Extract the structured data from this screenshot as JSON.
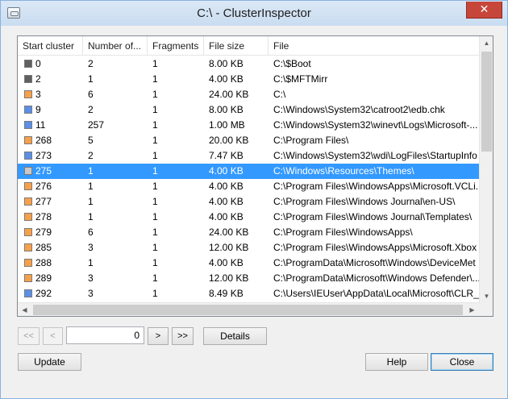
{
  "window": {
    "title": "C:\\ - ClusterInspector",
    "close_glyph": "✕"
  },
  "columns": [
    "Start cluster",
    "Number of...",
    "Fragments",
    "File size",
    "File"
  ],
  "rows": [
    {
      "cluster": "0",
      "count": "2",
      "frags": "1",
      "size": "8.00 KB",
      "file": "C:\\$Boot",
      "color": "#606060"
    },
    {
      "cluster": "2",
      "count": "1",
      "frags": "1",
      "size": "4.00 KB",
      "file": "C:\\$MFTMirr",
      "color": "#606060"
    },
    {
      "cluster": "3",
      "count": "6",
      "frags": "1",
      "size": "24.00 KB",
      "file": "C:\\",
      "color": "#f7a04a"
    },
    {
      "cluster": "9",
      "count": "2",
      "frags": "1",
      "size": "8.00 KB",
      "file": "C:\\Windows\\System32\\catroot2\\edb.chk",
      "color": "#5b8fe8"
    },
    {
      "cluster": "11",
      "count": "257",
      "frags": "1",
      "size": "1.00 MB",
      "file": "C:\\Windows\\System32\\winevt\\Logs\\Microsoft-...",
      "color": "#5b8fe8"
    },
    {
      "cluster": "268",
      "count": "5",
      "frags": "1",
      "size": "20.00 KB",
      "file": "C:\\Program Files\\",
      "color": "#f7a04a"
    },
    {
      "cluster": "273",
      "count": "2",
      "frags": "1",
      "size": "7.47 KB",
      "file": "C:\\Windows\\System32\\wdi\\LogFiles\\StartupInfo",
      "color": "#5b8fe8"
    },
    {
      "cluster": "275",
      "count": "1",
      "frags": "1",
      "size": "4.00 KB",
      "file": "C:\\Windows\\Resources\\Themes\\",
      "color": "#c8c8c8"
    },
    {
      "cluster": "276",
      "count": "1",
      "frags": "1",
      "size": "4.00 KB",
      "file": "C:\\Program Files\\WindowsApps\\Microsoft.VCLi...",
      "color": "#f7a04a"
    },
    {
      "cluster": "277",
      "count": "1",
      "frags": "1",
      "size": "4.00 KB",
      "file": "C:\\Program Files\\Windows Journal\\en-US\\",
      "color": "#f7a04a"
    },
    {
      "cluster": "278",
      "count": "1",
      "frags": "1",
      "size": "4.00 KB",
      "file": "C:\\Program Files\\Windows Journal\\Templates\\",
      "color": "#f7a04a"
    },
    {
      "cluster": "279",
      "count": "6",
      "frags": "1",
      "size": "24.00 KB",
      "file": "C:\\Program Files\\WindowsApps\\",
      "color": "#f7a04a"
    },
    {
      "cluster": "285",
      "count": "3",
      "frags": "1",
      "size": "12.00 KB",
      "file": "C:\\Program Files\\WindowsApps\\Microsoft.Xbox",
      "color": "#f7a04a"
    },
    {
      "cluster": "288",
      "count": "1",
      "frags": "1",
      "size": "4.00 KB",
      "file": "C:\\ProgramData\\Microsoft\\Windows\\DeviceMet",
      "color": "#f7a04a"
    },
    {
      "cluster": "289",
      "count": "3",
      "frags": "1",
      "size": "12.00 KB",
      "file": "C:\\ProgramData\\Microsoft\\Windows Defender\\...",
      "color": "#f7a04a"
    },
    {
      "cluster": "292",
      "count": "3",
      "frags": "1",
      "size": "8.49 KB",
      "file": "C:\\Users\\IEUser\\AppData\\Local\\Microsoft\\CLR_...",
      "color": "#5b8fe8"
    }
  ],
  "selected_row": 7,
  "pager": {
    "first": "<<",
    "prev": "<",
    "value": "0",
    "next": ">",
    "last": ">>",
    "details": "Details"
  },
  "footer": {
    "update": "Update",
    "help": "Help",
    "close": "Close"
  },
  "colors": {
    "selection": "#3399ff",
    "orange": "#f7a04a",
    "blue": "#5b8fe8",
    "dark_gray": "#606060"
  }
}
